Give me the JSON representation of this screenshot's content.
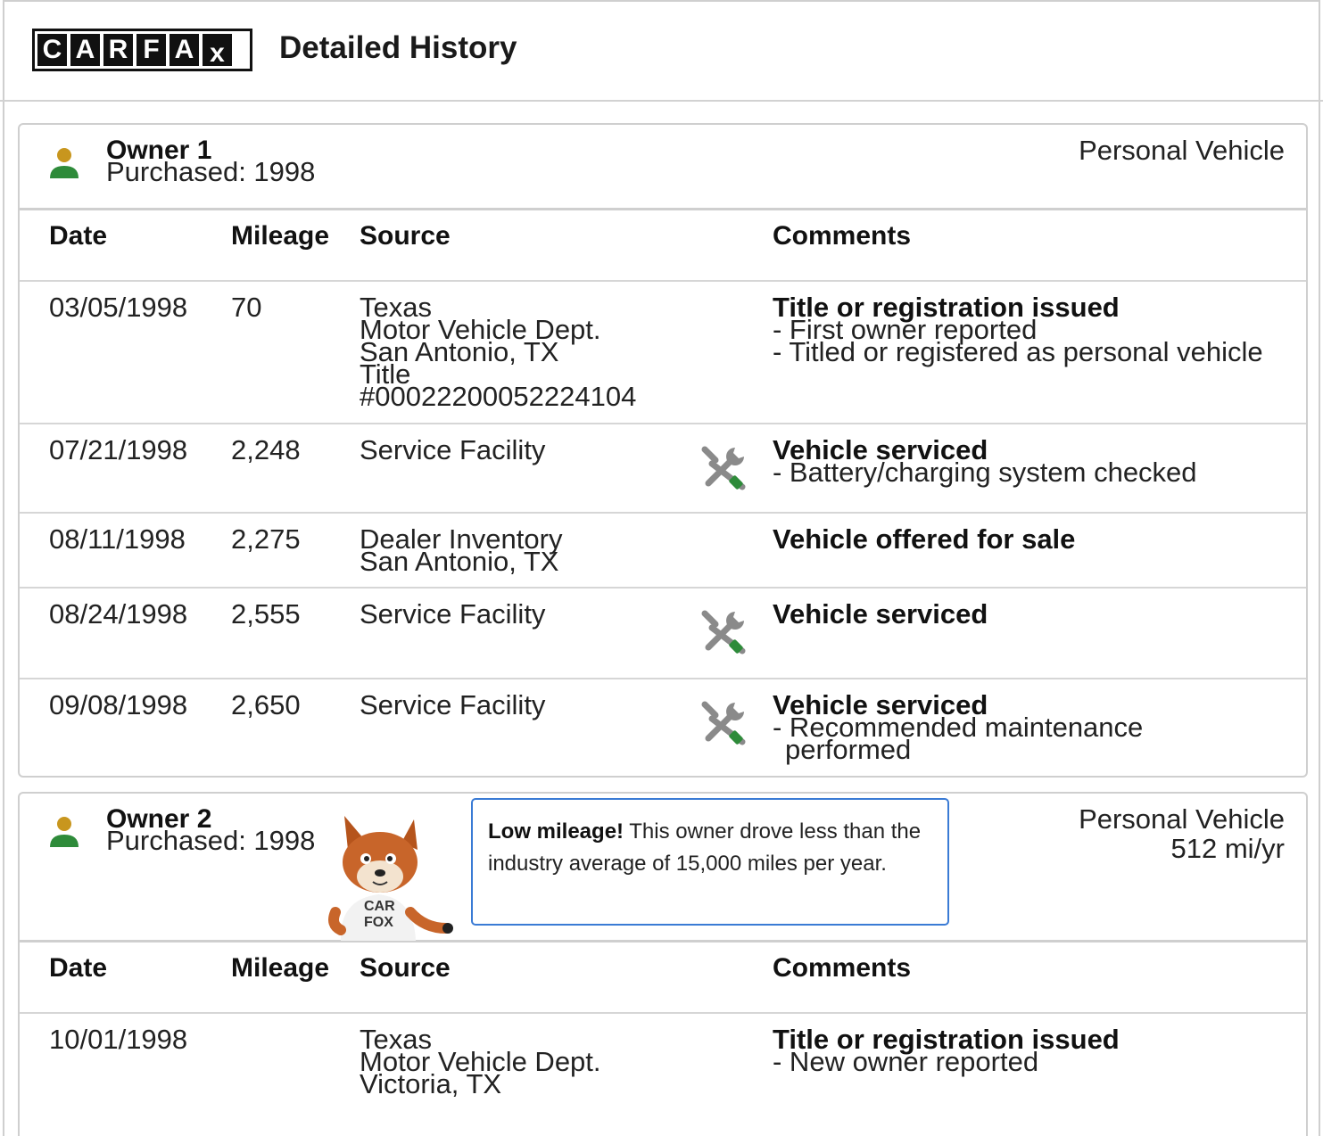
{
  "header": {
    "logo_letters": [
      "C",
      "A",
      "R",
      "F",
      "A",
      "X"
    ],
    "title": "Detailed History"
  },
  "columns": {
    "date": "Date",
    "mileage": "Mileage",
    "source": "Source",
    "comments": "Comments"
  },
  "owners": [
    {
      "name": "Owner 1",
      "purchased": "Purchased: 1998",
      "type": "Personal Vehicle",
      "rows": [
        {
          "date": "03/05/1998",
          "mileage": "70",
          "source": [
            "Texas",
            "Motor Vehicle Dept.",
            "San Antonio, TX",
            "Title",
            "#00022200052224104"
          ],
          "icon": "",
          "title": "Title or registration issued",
          "details": [
            "- First owner reported",
            "- Titled or registered as personal vehicle"
          ]
        },
        {
          "date": "07/21/1998",
          "mileage": "2,248",
          "source": [
            "Service Facility"
          ],
          "icon": "wrench-icon",
          "title": "Vehicle serviced",
          "details": [
            "- Battery/charging system checked"
          ]
        },
        {
          "date": "08/11/1998",
          "mileage": "2,275",
          "source": [
            "Dealer Inventory",
            "San Antonio, TX"
          ],
          "icon": "",
          "title": "Vehicle offered for sale",
          "details": []
        },
        {
          "date": "08/24/1998",
          "mileage": "2,555",
          "source": [
            "Service Facility"
          ],
          "icon": "wrench-icon",
          "title": "Vehicle serviced",
          "details": []
        },
        {
          "date": "09/08/1998",
          "mileage": "2,650",
          "source": [
            "Service Facility"
          ],
          "icon": "wrench-icon",
          "title": "Vehicle serviced",
          "details": [
            "- Recommended maintenance performed"
          ]
        }
      ]
    },
    {
      "name": "Owner 2",
      "purchased": "Purchased: 1998",
      "type": "Personal Vehicle",
      "annual_mileage": "512 mi/yr",
      "callout": {
        "bold": "Low mileage!",
        "text": " This owner drove less than the industry average of 15,000 miles per year."
      },
      "mascot_shirt": "CAR FOX",
      "rows": [
        {
          "date": "10/01/1998",
          "mileage": "",
          "source": [
            "Texas",
            "Motor Vehicle Dept.",
            "Victoria, TX"
          ],
          "icon": "",
          "title": "Title or registration issued",
          "details": [
            "- New owner reported"
          ]
        }
      ]
    }
  ],
  "colors": {
    "person_head": "#c8961e",
    "person_body": "#2e8b3a",
    "wrench_grey": "#8a8a8a",
    "wrench_green": "#2e8b3a",
    "callout_border": "#3a7bd5"
  }
}
